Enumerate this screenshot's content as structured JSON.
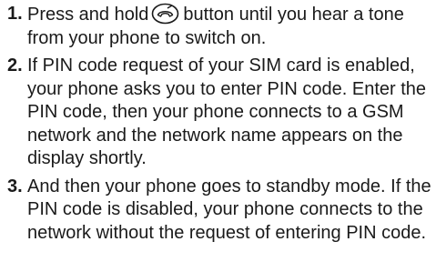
{
  "steps": [
    {
      "number": "1.",
      "text_before_icon": "Press and hold",
      "icon": "end-call-power-icon",
      "text_after_icon": "button until you hear a tone from your phone to switch on."
    },
    {
      "number": "2.",
      "text": "If PIN code request of your SIM card is enabled, your phone asks you to enter PIN code. Enter the PIN code, then your phone connects to a GSM network and the network name appears on the display shortly."
    },
    {
      "number": "3.",
      "text": "And then your phone goes to standby mode. If the PIN code is disabled, your phone connects to the network without the request of entering PIN code."
    }
  ]
}
